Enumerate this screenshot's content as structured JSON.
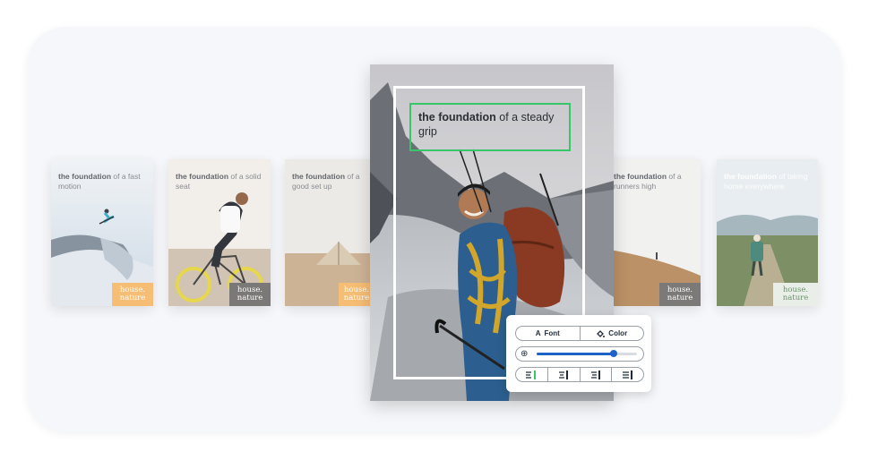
{
  "brand": {
    "logo_line1": "house.",
    "logo_line2": "nature",
    "accent": "#38c66a",
    "logo_orange": "#f7b866"
  },
  "cards": [
    {
      "bold": "the foundation",
      "rest": " of a fast motion"
    },
    {
      "bold": "the foundation",
      "rest": " of a solid seat"
    },
    {
      "bold": "the foundation",
      "rest": " of a good set up"
    },
    {
      "bold": "the foundation",
      "rest": " of a runners high"
    },
    {
      "bold": "the foundation",
      "rest": " of taking home everywhere"
    }
  ],
  "main": {
    "bold": "the foundation",
    "rest": " of a steady grip"
  },
  "toolbar": {
    "font_label": "Font",
    "color_label": "Color",
    "zoom_level": 0.77,
    "align_icons": [
      "align-left-icon",
      "align-center-icon",
      "align-right-icon",
      "align-justify-icon"
    ]
  }
}
